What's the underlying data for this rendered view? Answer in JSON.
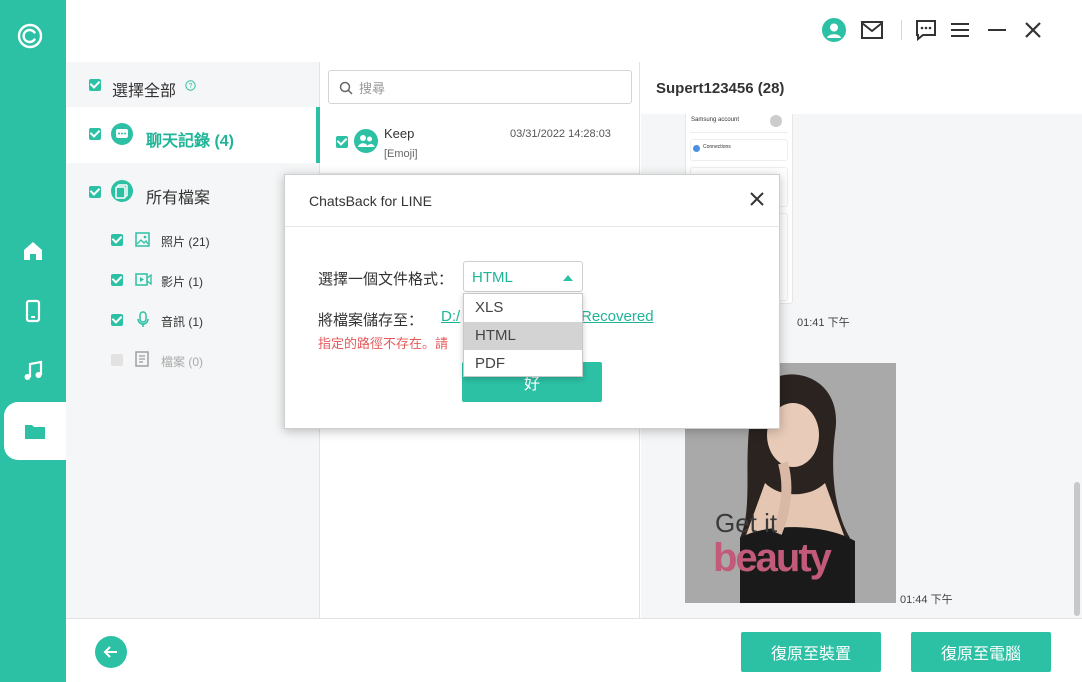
{
  "app": {
    "title": "ChatsBack for LINE",
    "accent": "#2cc0a4"
  },
  "rail": {
    "items": [
      {
        "name": "home",
        "icon": "home-icon"
      },
      {
        "name": "device",
        "icon": "phone-icon"
      },
      {
        "name": "music",
        "icon": "music-icon"
      },
      {
        "name": "files",
        "icon": "folder-icon",
        "active": true
      }
    ]
  },
  "categories": {
    "select_all": "選擇全部",
    "chats": "聊天記錄 (4)",
    "all_files": "所有檔案",
    "sub": [
      {
        "label": "照片 (21)",
        "icon": "image-icon",
        "checked": true
      },
      {
        "label": "影片 (1)",
        "icon": "video-icon",
        "checked": true
      },
      {
        "label": "音訊 (1)",
        "icon": "mic-icon",
        "checked": true
      },
      {
        "label": "檔案 (0)",
        "icon": "file-icon",
        "checked": false
      }
    ]
  },
  "search": {
    "placeholder": "搜尋"
  },
  "chat_list": [
    {
      "name": "Keep",
      "preview": "[Emoji]",
      "time": "03/31/2022 14:28:03"
    }
  ],
  "conversation": {
    "title": "Supert123456 (28)",
    "shot_rows": [
      "Samsung account",
      "Connections"
    ],
    "messages": [
      {
        "time": "01:41 下午"
      },
      {
        "time": "01:44 下午"
      }
    ],
    "photo_text": [
      "Get it",
      "beauty"
    ]
  },
  "bottom": {
    "restore_device": "復原至裝置",
    "restore_pc": "復原至電腦"
  },
  "dialog": {
    "title": "ChatsBack for LINE",
    "format_label": "選擇一個文件格式：",
    "format_value": "HTML",
    "options": [
      "XLS",
      "HTML",
      "PDF"
    ],
    "selected_index": 1,
    "save_label": "將檔案儲存至：",
    "path_start": "D:/",
    "path_end": "Recovered",
    "error": "指定的路徑不存在。請",
    "ok": "好"
  }
}
